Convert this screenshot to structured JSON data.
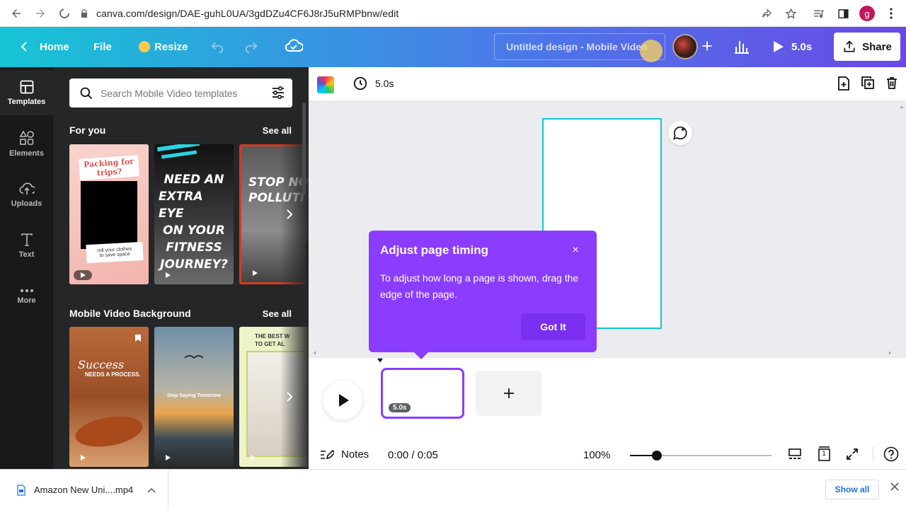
{
  "browser": {
    "url": "canva.com/design/DAE-guhL0UA/3gdDZu4CF6J8rJ5uRMPbnw/edit",
    "profile_initial": "g"
  },
  "header": {
    "home_label": "Home",
    "file_label": "File",
    "resize_label": "Resize",
    "design_title": "Untitled design - Mobile Video",
    "play_duration": "5.0s",
    "share_label": "Share",
    "gradient_start": "#16c5d5",
    "gradient_end": "#6a49e6"
  },
  "rail": {
    "items": [
      {
        "label": "Templates",
        "icon": "templates-icon"
      },
      {
        "label": "Elements",
        "icon": "elements-icon"
      },
      {
        "label": "Uploads",
        "icon": "uploads-icon"
      },
      {
        "label": "Text",
        "icon": "text-icon"
      },
      {
        "label": "More",
        "icon": "more-icon"
      }
    ]
  },
  "panel": {
    "search_placeholder": "Search Mobile Video templates",
    "sections": [
      {
        "title": "For you",
        "see_all": "See all",
        "thumbs": [
          {
            "lines": [
              "Packing for",
              "trips?"
            ],
            "foot": [
              "roll your clothes",
              "to save space"
            ]
          },
          {
            "lines": [
              "NEED AN",
              "EXTRA EYE",
              "ON YOUR",
              "FITNESS",
              "JOURNEY?"
            ]
          },
          {
            "lines": [
              "STOP NO",
              "POLLUTI"
            ]
          }
        ]
      },
      {
        "title": "Mobile Video Background",
        "see_all": "See all",
        "thumbs": [
          {
            "lines": [
              "Success",
              "NEEDS A PROCESS."
            ]
          },
          {
            "lines": [
              "Stop Saying Tomorrow"
            ]
          },
          {
            "lines": [
              "THE BEST W",
              "TO GET AL"
            ]
          }
        ]
      }
    ]
  },
  "toolbar": {
    "duration": "5.0s"
  },
  "tooltip": {
    "title": "Adjust page timing",
    "close": "×",
    "body": "To adjust how long a page is shown, drag the edge of the page.",
    "button": "Got It",
    "color": "#8b3dff"
  },
  "timeline": {
    "clip_duration": "5.0s",
    "add_symbol": "+"
  },
  "bottombar": {
    "notes_label": "Notes",
    "timecode": "0:00 / 0:05",
    "zoom_level": "100%",
    "zoom_fraction": 0.19,
    "page_count": "1"
  },
  "downloads": {
    "file_name": "Amazon New Uni....mp4",
    "show_all": "Show all"
  }
}
